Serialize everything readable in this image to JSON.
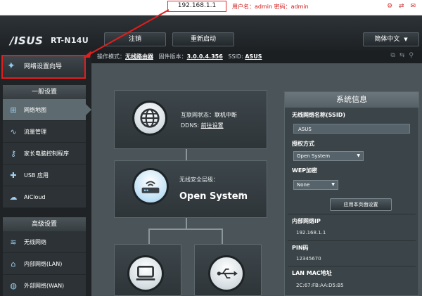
{
  "browser": {
    "url": "192.168.1.1",
    "login_hint": "用户名：admin 密码：admin",
    "toolbar_icons": "⚙ ⇄ ✉"
  },
  "header": {
    "brand": "/ISUS",
    "model": "RT-N14U",
    "logout_label": "注销",
    "reboot_label": "重新启动",
    "language": "简体中文"
  },
  "status": {
    "mode_label": "操作模式：",
    "mode_value": "无线路由器",
    "firmware_label": "固件版本：",
    "firmware_value": "3.0.0.4.356",
    "ssid_label": "SSID:",
    "ssid_value": "ASUS"
  },
  "sidebar": {
    "wizard": "网络设置向导",
    "general_header": "一般设置",
    "general_items": [
      {
        "label": "网络地图",
        "icon": "network-map-icon"
      },
      {
        "label": "流量管理",
        "icon": "traffic-icon"
      },
      {
        "label": "家长电脑控制程序",
        "icon": "parental-control-icon"
      },
      {
        "label": "USB 应用",
        "icon": "usb-app-icon"
      },
      {
        "label": "AiCloud",
        "icon": "cloud-icon"
      }
    ],
    "advanced_header": "高级设置",
    "advanced_items": [
      {
        "label": "无线网络",
        "icon": "wifi-icon"
      },
      {
        "label": "内部网络(LAN)",
        "icon": "lan-icon"
      },
      {
        "label": "外部网络(WAN)",
        "icon": "wan-icon"
      }
    ]
  },
  "network_map": {
    "internet_status_label": "互联网状态：",
    "internet_status_value": "联机中断",
    "ddns_label": "DDNS:",
    "ddns_value": "前往设置",
    "wireless_security_label": "无线安全层级：",
    "wireless_security_value": "Open System"
  },
  "system_info": {
    "title": "系统信息",
    "ssid_label": "无线网络名称(SSID)",
    "ssid_value": "ASUS",
    "auth_label": "授权方式",
    "auth_value": "Open System",
    "wep_label": "WEP加密",
    "wep_value": "None",
    "apply_label": "应用本页面设置",
    "lan_ip_label": "内部网络IP",
    "lan_ip_value": "192.168.1.1",
    "pin_label": "PIN码",
    "pin_value": "12345670",
    "lan_mac_label": "LAN MAC地址",
    "lan_mac_value": "2C:67:FB:AA:D5:B5"
  }
}
